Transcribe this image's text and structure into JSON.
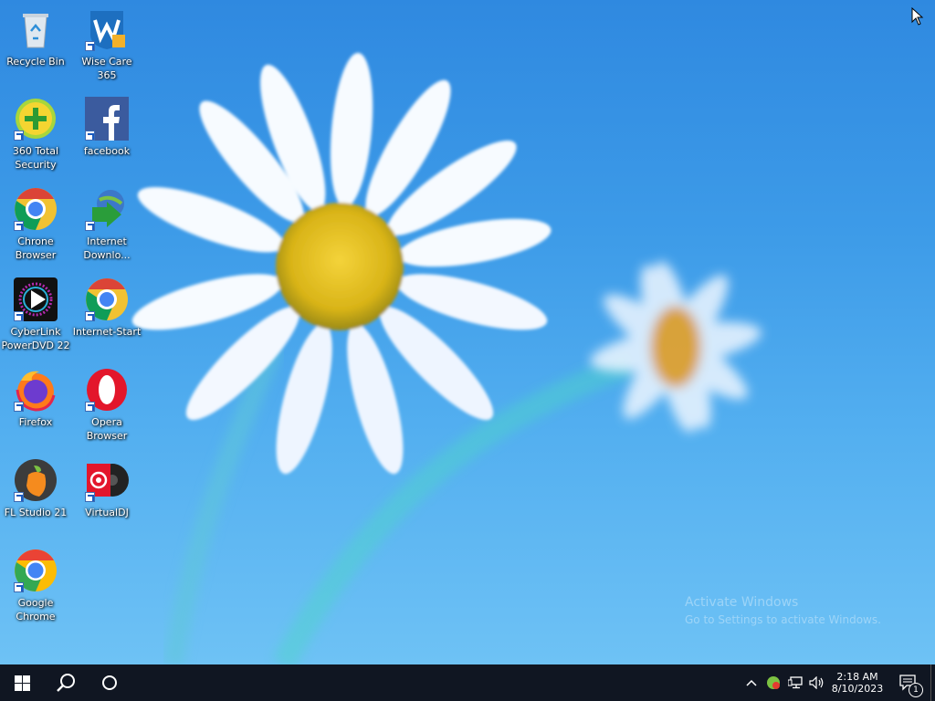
{
  "desktop": {
    "icons": [
      {
        "label": "Recycle Bin",
        "icon": "recycle-bin-icon"
      },
      {
        "label": "Wise Care 365",
        "icon": "wise-care-icon"
      },
      {
        "label": "360 Total Security",
        "icon": "360-security-icon"
      },
      {
        "label": "facebook",
        "icon": "facebook-icon"
      },
      {
        "label": "Chrone Browser",
        "icon": "chrone-browser-icon"
      },
      {
        "label": "Internet Downlo...",
        "icon": "internet-download-manager-icon"
      },
      {
        "label": "CyberLink PowerDVD 22",
        "icon": "powerdvd-icon"
      },
      {
        "label": "Internet-Start",
        "icon": "internet-start-icon"
      },
      {
        "label": "Firefox",
        "icon": "firefox-icon"
      },
      {
        "label": "Opera Browser",
        "icon": "opera-icon"
      },
      {
        "label": "FL Studio 21",
        "icon": "fl-studio-icon"
      },
      {
        "label": "VirtualDJ",
        "icon": "virtualdj-icon"
      },
      {
        "label": "Google Chrome",
        "icon": "google-chrome-icon"
      }
    ],
    "watermark": {
      "line1": "Activate Windows",
      "line2": "Go to Settings to activate Windows."
    }
  },
  "taskbar": {
    "time": "2:18 AM",
    "date": "8/10/2023",
    "notification_count": "1",
    "colors": {
      "background": "#101622",
      "accent": "#ffffff"
    }
  }
}
